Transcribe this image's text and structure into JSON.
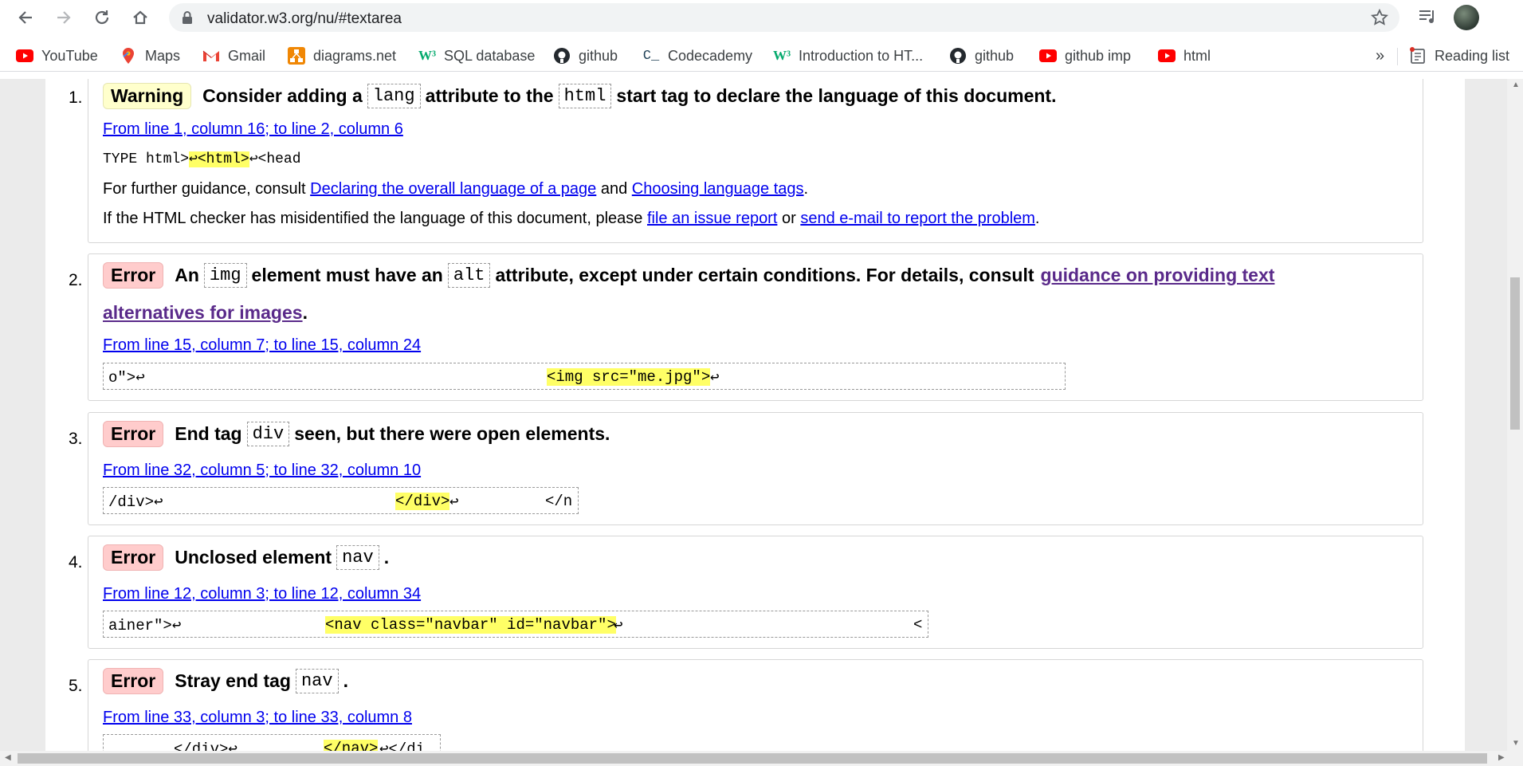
{
  "browser": {
    "url": "validator.w3.org/nu/#textarea",
    "bookmarks": [
      {
        "label": "YouTube",
        "icon": "youtube-icon"
      },
      {
        "label": "Maps",
        "icon": "maps-icon"
      },
      {
        "label": "Gmail",
        "icon": "gmail-icon"
      },
      {
        "label": "diagrams.net",
        "icon": "diagrams-icon"
      },
      {
        "label": "SQL database",
        "icon": "w3schools-icon"
      },
      {
        "label": "github",
        "icon": "github-icon"
      },
      {
        "label": "Codecademy",
        "icon": "codecademy-icon"
      },
      {
        "label": "Introduction to HT...",
        "icon": "w3schools-icon"
      },
      {
        "label": "github",
        "icon": "github-icon"
      },
      {
        "label": "github imp",
        "icon": "youtube-icon"
      },
      {
        "label": "html",
        "icon": "youtube-icon"
      }
    ],
    "overflow_label": "»",
    "reading_list": "Reading list"
  },
  "messages": [
    {
      "num": "1.",
      "type": "Warning",
      "head_pre": "Consider adding a",
      "tok1": "lang",
      "head_mid": "attribute to the",
      "tok2": "html",
      "head_post": "start tag to declare the language of this document.",
      "location": "From line 1, column 16; to line 2, column 6",
      "extract_pre": "TYPE html>",
      "extract_hl": "↩<html>",
      "extract_post": "↩<head",
      "guidance_pre": "For further guidance, consult",
      "guidance_link1": "Declaring the overall language of a page",
      "guidance_and": "and",
      "guidance_link2": "Choosing language tags",
      "guidance_end": ".",
      "misid_pre": "If the HTML checker has misidentified the language of this document, please",
      "misid_link1": "file an issue report",
      "misid_or": "or",
      "misid_link2": "send e-mail to report the problem",
      "misid_end": "."
    },
    {
      "num": "2.",
      "type": "Error",
      "head_pre": "An",
      "tok1": "img",
      "head_mid": "element must have an",
      "tok2": "alt",
      "head_post": "attribute, except under certain conditions. For details, consult",
      "head_link_a": "guidance on providing text",
      "head_link_b": "alternatives for images",
      "head_end": ".",
      "location": "From line 15, column 7; to line 15, column 24",
      "extract_pre": "o\">↩",
      "extract_hl": "<img src=\"me.jpg\">",
      "extract_post": "↩"
    },
    {
      "num": "3.",
      "type": "Error",
      "head_pre": "End tag",
      "tok1": "div",
      "head_post": "seen, but there were open elements.",
      "location": "From line 32, column 5; to line 32, column 10",
      "extract_pre": "/div>↩",
      "extract_hl": "</div>",
      "extract_post": "↩",
      "extract_tail": "</n"
    },
    {
      "num": "4.",
      "type": "Error",
      "head_pre": "Unclosed element",
      "tok1": "nav",
      "head_end": ".",
      "location": "From line 12, column 3; to line 12, column 34",
      "extract_pre": "ainer\">↩",
      "extract_hl": "<nav class=\"navbar\" id=\"navbar\">",
      "extract_post": "↩",
      "extract_tail": "<"
    },
    {
      "num": "5.",
      "type": "Error",
      "head_pre": "Stray end tag",
      "tok1": "nav",
      "head_end": ".",
      "location": "From line 33, column 3; to line 33, column 8",
      "extract_pre": "</div>↩",
      "extract_hl": "</nav>",
      "extract_post": "↩</di"
    }
  ]
}
